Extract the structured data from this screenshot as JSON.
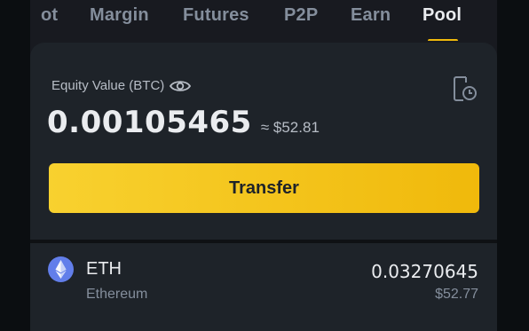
{
  "tabs": [
    {
      "label": "ot",
      "active": false
    },
    {
      "label": "Margin",
      "active": false
    },
    {
      "label": "Futures",
      "active": false
    },
    {
      "label": "P2P",
      "active": false
    },
    {
      "label": "Earn",
      "active": false
    },
    {
      "label": "Pool",
      "active": true
    }
  ],
  "equity": {
    "label": "Equity Value (BTC)",
    "value": "0.00105465",
    "approx": "≈ $52.81",
    "visibility_icon": "eye-icon",
    "history_icon": "history-icon"
  },
  "transfer": {
    "label": "Transfer"
  },
  "assets": [
    {
      "symbol": "ETH",
      "name": "Ethereum",
      "amount": "0.03270645",
      "value": "$52.77",
      "icon": "ethereum-icon"
    }
  ],
  "colors": {
    "accent": "#f0b90b",
    "background": "#181a20",
    "card": "#1e2329",
    "text_primary": "#eaecef",
    "text_secondary": "#848e9c",
    "eth": "#627eea"
  }
}
